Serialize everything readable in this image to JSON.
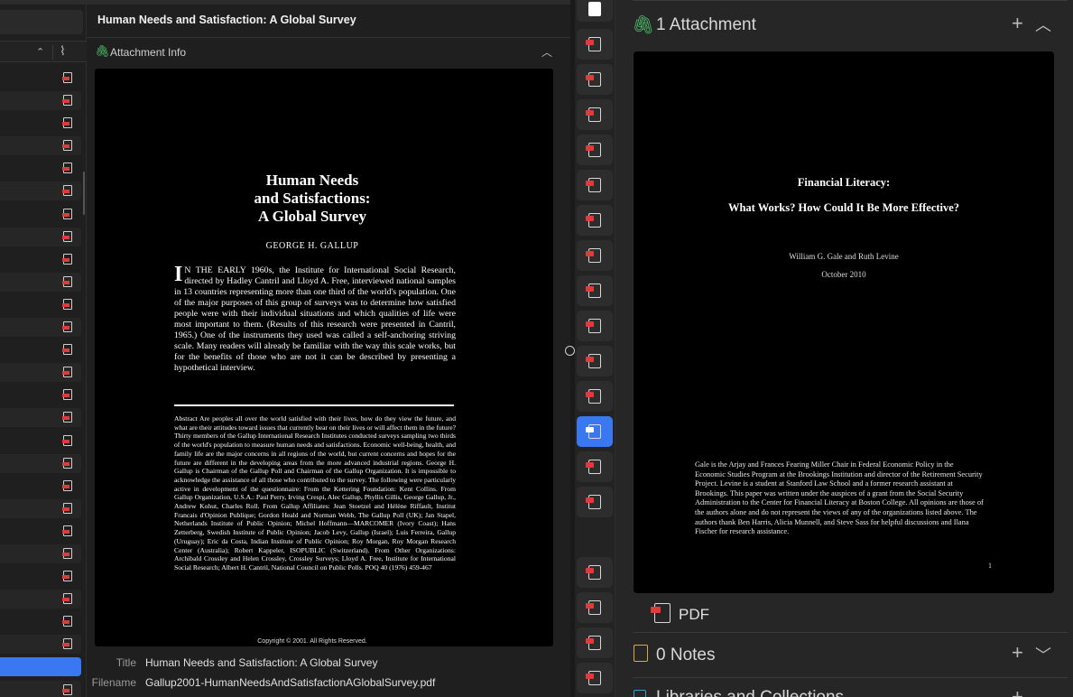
{
  "left": {
    "detail_title": "Human Needs and Satisfaction: A Global Survey",
    "section_label": "Attachment Info",
    "preview": {
      "title_lines": [
        "Human Needs",
        "and Satisfactions:",
        "A Global Survey"
      ],
      "author": "GEORGE H. GALLUP",
      "dropcap": "I",
      "body": "N THE EARLY 1960s, the Institute for International Social Research, directed by Hadley Cantril and Lloyd A. Free, interviewed national samples in 13 countries representing more than one third of the world's population. One of the major purposes of this group of surveys was to determine how satisfied people were with their individual situations and which qualities of life were most important to them. (Results of this research were presented in Cantril, 1965.) One of the instruments they used was called a self-anchoring striving scale. Many readers will already be familiar with the way this scale works, but for the benefits of those who are not it can be described by presenting a hypothetical interview.",
      "abstract": "Abstract  Are peoples all over the world satisfied with their lives, how do they view the future, and what are their attitudes toward issues that currently bear on their lives or will affect them in the future? Thirty members of the Gallup International Research Institutes conducted surveys sampling two thirds of the world's population to measure human needs and satisfactions. Economic well-being, health, and family life are the major concerns in all regions of the world, but current concerns and hopes for the future are different in the developing areas from the more advanced industrial regions. George H. Gallup is Chairman of the Gallup Poll and Chairman of the Gallup Organization. It is impossible to acknowledge the assistance of all those who contributed to the survey. The following were particularly active in development of the questionnaire: From the Kettering Foundation: Kent Collins. From Gallup Organization, U.S.A.: Paul Perry, Irving Crespi, Alec Gallup, Phyllis Gillis, George Gallup, Jr., Andrew Kohut, Charles Roll. From Gallup Affiliates: Jean Stoetzel and Hélène Riffault, Institut Francais d'Opinion Publique; Gordon Heald and Norman Webb, The Gallup Poll (UK); Jan Stapel, Netherlands Institute of Public Opinion; Michel Hoffmann—MARCOMER (Ivory Coast); Hans Zetterberg, Swedish Institute of Public Opinion; Jacob Levy, Gallup (Israel); Luis Ferreira, Gallup (Uruguay); Eric da Costa, Indian Institute of Public Opinion; Roy Morgan, Roy Morgan Research Center (Australia); Robert Kappeler, ISOPUBLIC (Switzerland). From Other Organizations: Archibald Crossley and Helen Crossley, Crossley Surveys; Lloyd A. Free, Institute for International Social Research; Albert H. Cantril, National Council on Public Polls.  POQ 40 (1976) 459-467",
      "copyright": "Copyright © 2001. All Rights Reserved."
    },
    "meta": {
      "title_key": "Title",
      "title_value": "Human Needs and Satisfaction: A Global Survey",
      "filename_key": "Filename",
      "filename_value": "Gallup2001-HumanNeedsAndSatisfactionAGlobalSurvey.pdf"
    }
  },
  "right": {
    "attachments_header": "1 Attachment",
    "preview": {
      "title": "Financial Literacy:",
      "subtitle": "What Works?  How Could It Be More Effective?",
      "authors": "William G. Gale and Ruth Levine",
      "date": "October 2010",
      "body": "Gale is the Arjay and Frances Fearing Miller Chair in Federal Economic Policy in the Economic Studies Program at the Brookings Institution and director of the Retirement Security Project.  Levine is a student at Stanford Law School and a former research assistant at Brookings.  This paper was written under the auspices of a grant from the Social Security Administration to the Center for Financial Literacy at Boston College.  All opinions are those of the authors alone and do not represent the views of any of the organizations listed above.  The authors thank Ben Harris, Alicia Munnell, and Steve Sass for helpful discussions and Ilana Fischer for research assistance.",
      "page_number": "1"
    },
    "pdf_label": "PDF",
    "notes_header": "0 Notes",
    "libraries_header": "Libraries and Collections"
  },
  "icons": {
    "plus": "+",
    "chevron_up": "︿",
    "chevron_down": "﹀",
    "paperclip": "🖇"
  },
  "colors": {
    "accent": "#3a78f2",
    "attachment_green": "#4fbf6a",
    "pdf_red": "#e03b3b",
    "notes_orange": "#e2a73b"
  }
}
